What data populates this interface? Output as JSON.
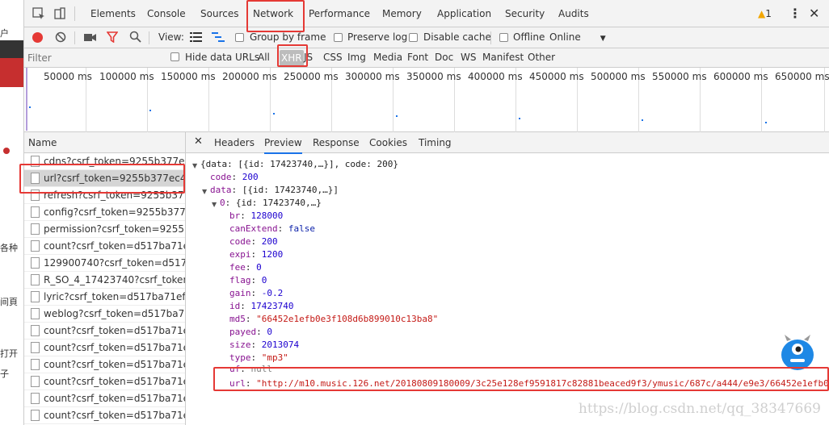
{
  "left_strip": {
    "texts": [
      "户",
      "各种",
      "间頁",
      "打开",
      "子"
    ]
  },
  "tabs": [
    "Elements",
    "Console",
    "Sources",
    "Network",
    "Performance",
    "Memory",
    "Application",
    "Security",
    "Audits"
  ],
  "warning_count": "1",
  "toolbar": {
    "view_label": "View:",
    "group_by_frame": "Group by frame",
    "preserve_log": "Preserve log",
    "disable_cache": "Disable cache",
    "offline": "Offline",
    "throttle": "Online"
  },
  "filter": {
    "placeholder": "Filter",
    "hide_data_urls": "Hide data URLs",
    "types": [
      "All",
      "XHR",
      "JS",
      "CSS",
      "Img",
      "Media",
      "Font",
      "Doc",
      "WS",
      "Manifest",
      "Other"
    ]
  },
  "overview_ticks": [
    "50000 ms",
    "100000 ms",
    "150000 ms",
    "200000 ms",
    "250000 ms",
    "300000 ms",
    "350000 ms",
    "400000 ms",
    "450000 ms",
    "500000 ms",
    "550000 ms",
    "600000 ms",
    "650000 ms"
  ],
  "requests": {
    "header": "Name",
    "items": [
      "cdns?csrf_token=9255b377ec4",
      "url?csrf_token=9255b377ec43...",
      "refresh?csrf_token=9255b377e...",
      "config?csrf_token=9255b377e...",
      "permission?csrf_token=9255b...",
      "count?csrf_token=d517ba71ef...",
      "129900740?csrf_token=d517b...",
      "R_SO_4_17423740?csrf_token=...",
      "lyric?csrf_token=d517ba71ef1...",
      "weblog?csrf_token=d517ba71...",
      "count?csrf_token=d517ba71ef...",
      "count?csrf_token=d517ba71ef...",
      "count?csrf_token=d517ba71ef...",
      "count?csrf_token=d517ba71ef...",
      "count?csrf_token=d517ba71ef...",
      "count?csrf_token=d517ba71ef..."
    ]
  },
  "detail_tabs": [
    "Headers",
    "Preview",
    "Response",
    "Cookies",
    "Timing"
  ],
  "preview": {
    "root": "{data: [{id: 17423740,…}], code: 200}",
    "code": "200",
    "data_summary": "[{id: 17423740,…}]",
    "item0_summary": "{id: 17423740,…}",
    "br": "128000",
    "canExtend": "false",
    "code_inner": "200",
    "expi": "1200",
    "fee": "0",
    "flag": "0",
    "gain": "-0.2",
    "id": "17423740",
    "md5": "\"66452e1efb0e3f108d6b899010c13ba8\"",
    "payed": "0",
    "size": "2013074",
    "type": "\"mp3\"",
    "uf": "null",
    "url": "\"http://m10.music.126.net/20180809180009/3c25e128ef9591817c82881beaced9f3/ymusic/687c/a444/e9e3/66452e1efb0e3"
  },
  "watermark": "https://blog.csdn.net/qq_38347669"
}
